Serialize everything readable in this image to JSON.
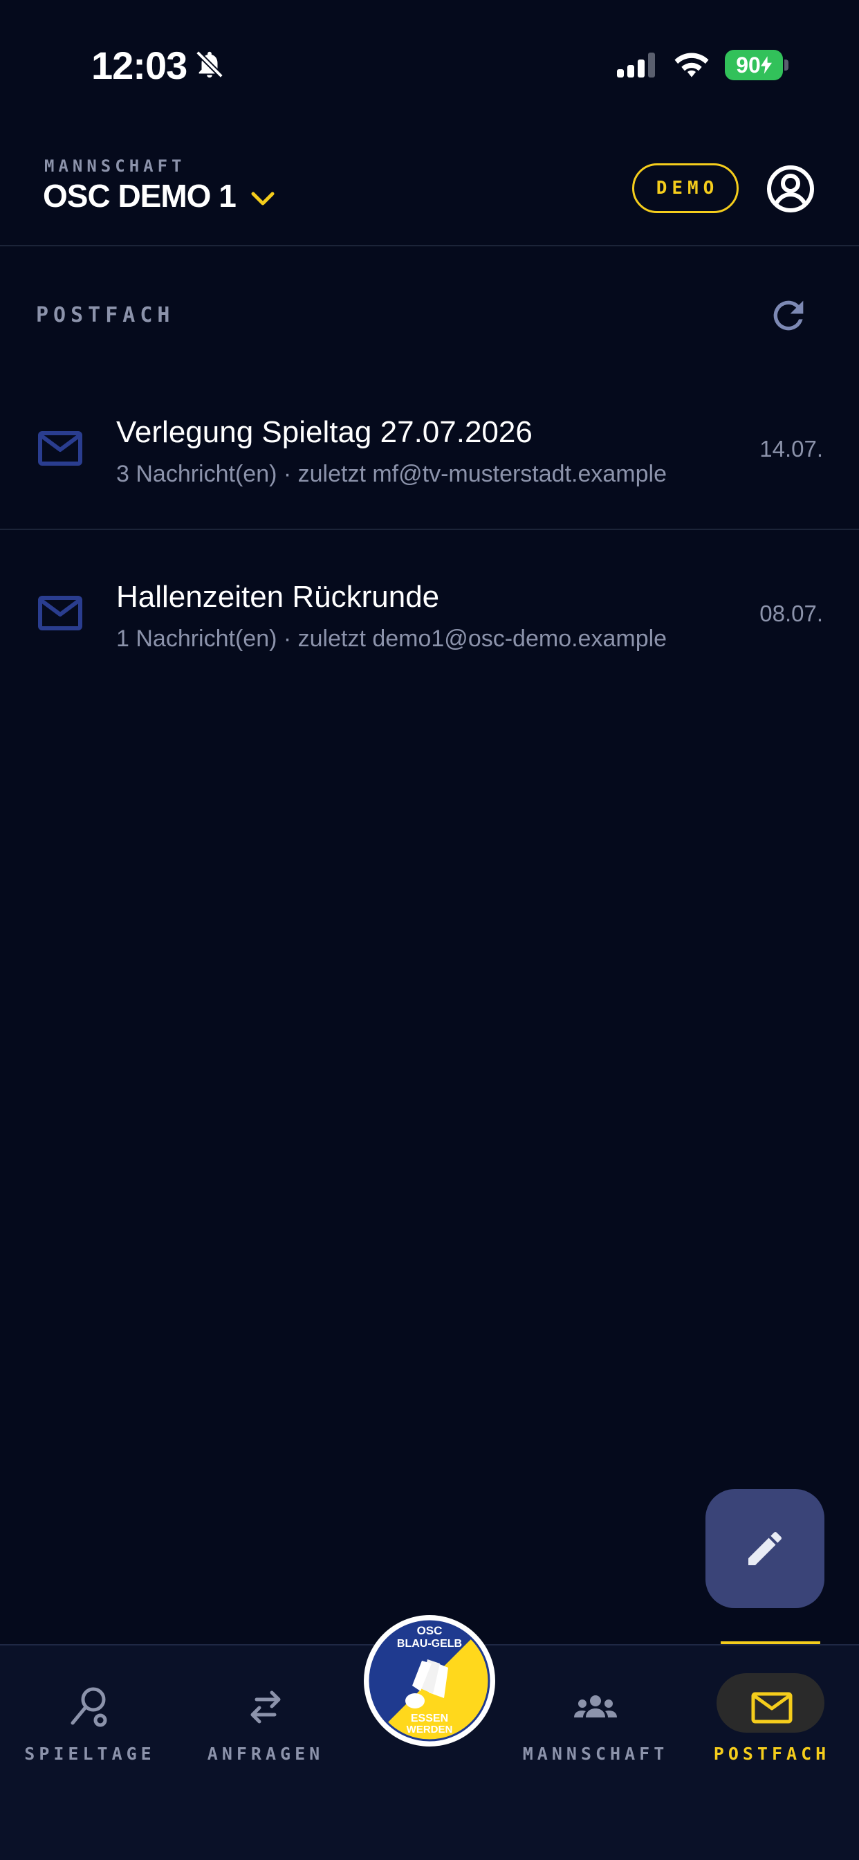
{
  "status_bar": {
    "time": "12:03",
    "battery": "90"
  },
  "header": {
    "team_caption": "MANNSCHAFT",
    "team_name": "OSC DEMO 1",
    "badge": "DEMO"
  },
  "section": {
    "title": "POSTFACH"
  },
  "messages": [
    {
      "subject": "Verlegung Spieltag 27.07.2026",
      "meta": "3 Nachricht(en) · zuletzt mf@tv-musterstadt.example",
      "date": "14.07."
    },
    {
      "subject": "Hallenzeiten Rückrunde",
      "meta": "1 Nachricht(en) · zuletzt demo1@osc-demo.example",
      "date": "08.07."
    }
  ],
  "bottom_nav": {
    "items": [
      {
        "label": "SPIELTAGE",
        "icon": "racket-icon"
      },
      {
        "label": "ANFRAGEN",
        "icon": "swap-arrows-icon"
      },
      {
        "label": "MANNSCHAFT",
        "icon": "group-icon"
      },
      {
        "label": "POSTFACH",
        "icon": "mail-icon",
        "active": true
      }
    ],
    "logo": {
      "top_text": "OSC",
      "mid_text": "BLAU-GELB",
      "bottom_text_1": "ESSEN",
      "bottom_text_2": "WERDEN"
    }
  },
  "colors": {
    "background": "#050a1c",
    "accent": "#f5cd1c",
    "muted": "#8c93ab",
    "icon_blue": "#2a3d8f",
    "fab": "#3a4478"
  },
  "icons": {
    "notifications": "bell-off-icon",
    "account": "account-circle-icon",
    "refresh": "refresh-icon",
    "message": "mail-icon",
    "compose": "pencil-icon",
    "team_switch": "chevron-down-icon"
  }
}
